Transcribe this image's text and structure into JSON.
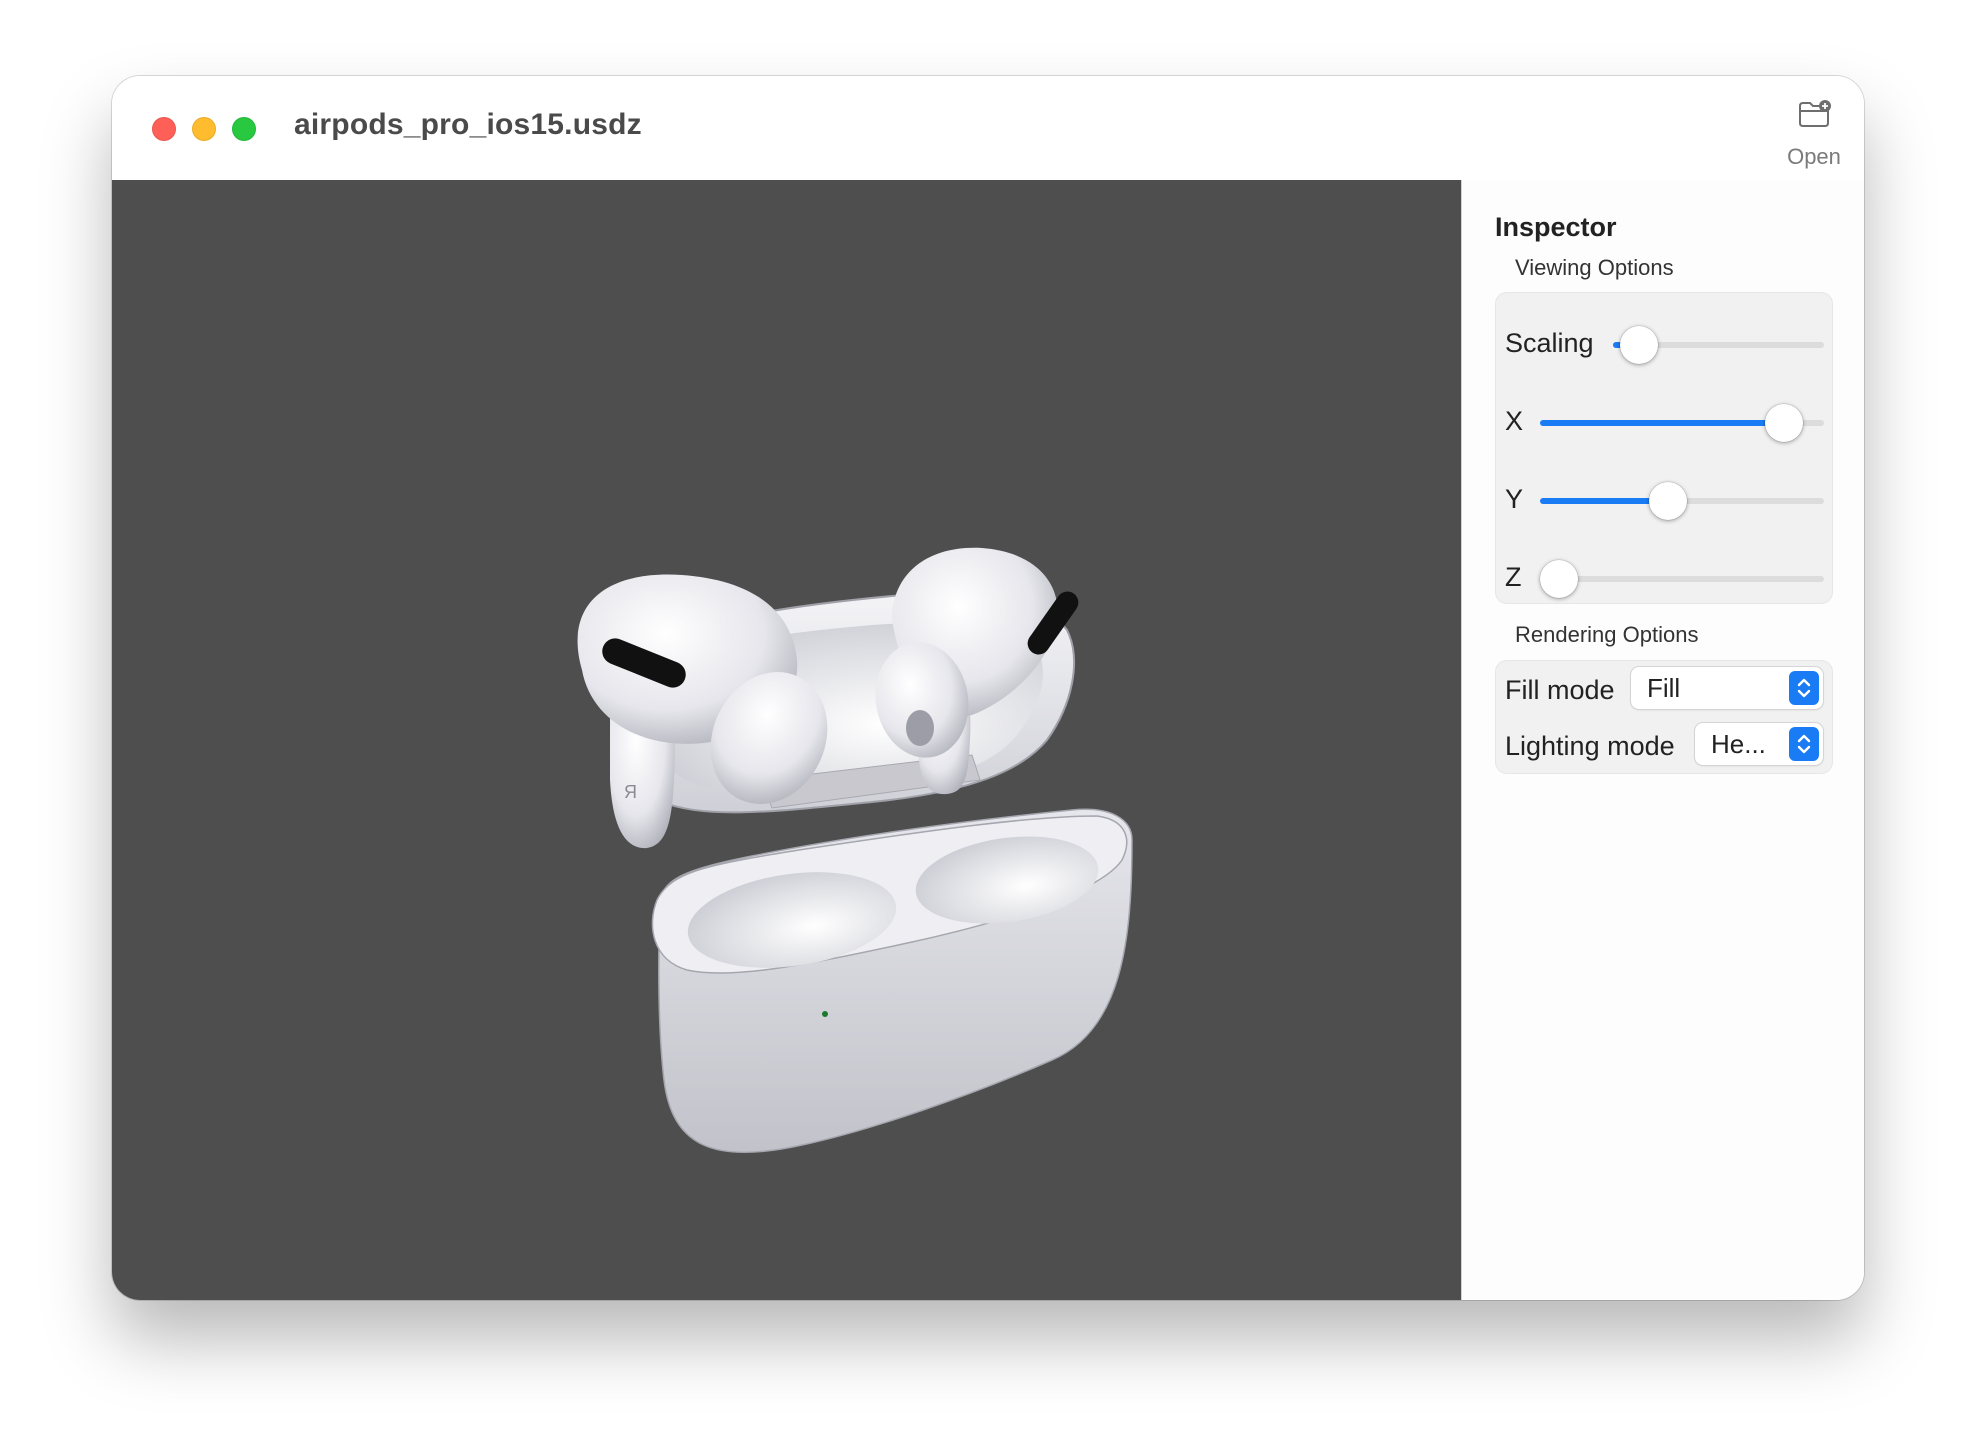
{
  "window": {
    "title": "airpods_pro_ios15.usdz"
  },
  "toolbar": {
    "open_label": "Open",
    "open_icon": "folder-plus-icon"
  },
  "inspector": {
    "title": "Inspector",
    "viewing_options": {
      "label": "Viewing Options",
      "sliders": [
        {
          "label": "Scaling",
          "value": 0.09
        },
        {
          "label": "X",
          "value": 0.86
        },
        {
          "label": "Y",
          "value": 0.45
        },
        {
          "label": "Z",
          "value": 0.0
        }
      ]
    },
    "rendering_options": {
      "label": "Rendering Options",
      "fill_mode": {
        "label": "Fill mode",
        "value": "Fill"
      },
      "lighting_mode": {
        "label": "Lighting mode",
        "value": "He..."
      }
    }
  },
  "colors": {
    "accent": "#1a7cf5",
    "viewport_bg": "#4e4e4e",
    "close": "#fe5f57",
    "minimize": "#febc2e",
    "maximize": "#28c840"
  },
  "viewport": {
    "content": "airpods-pro-3d-model",
    "case_mark": "R"
  }
}
